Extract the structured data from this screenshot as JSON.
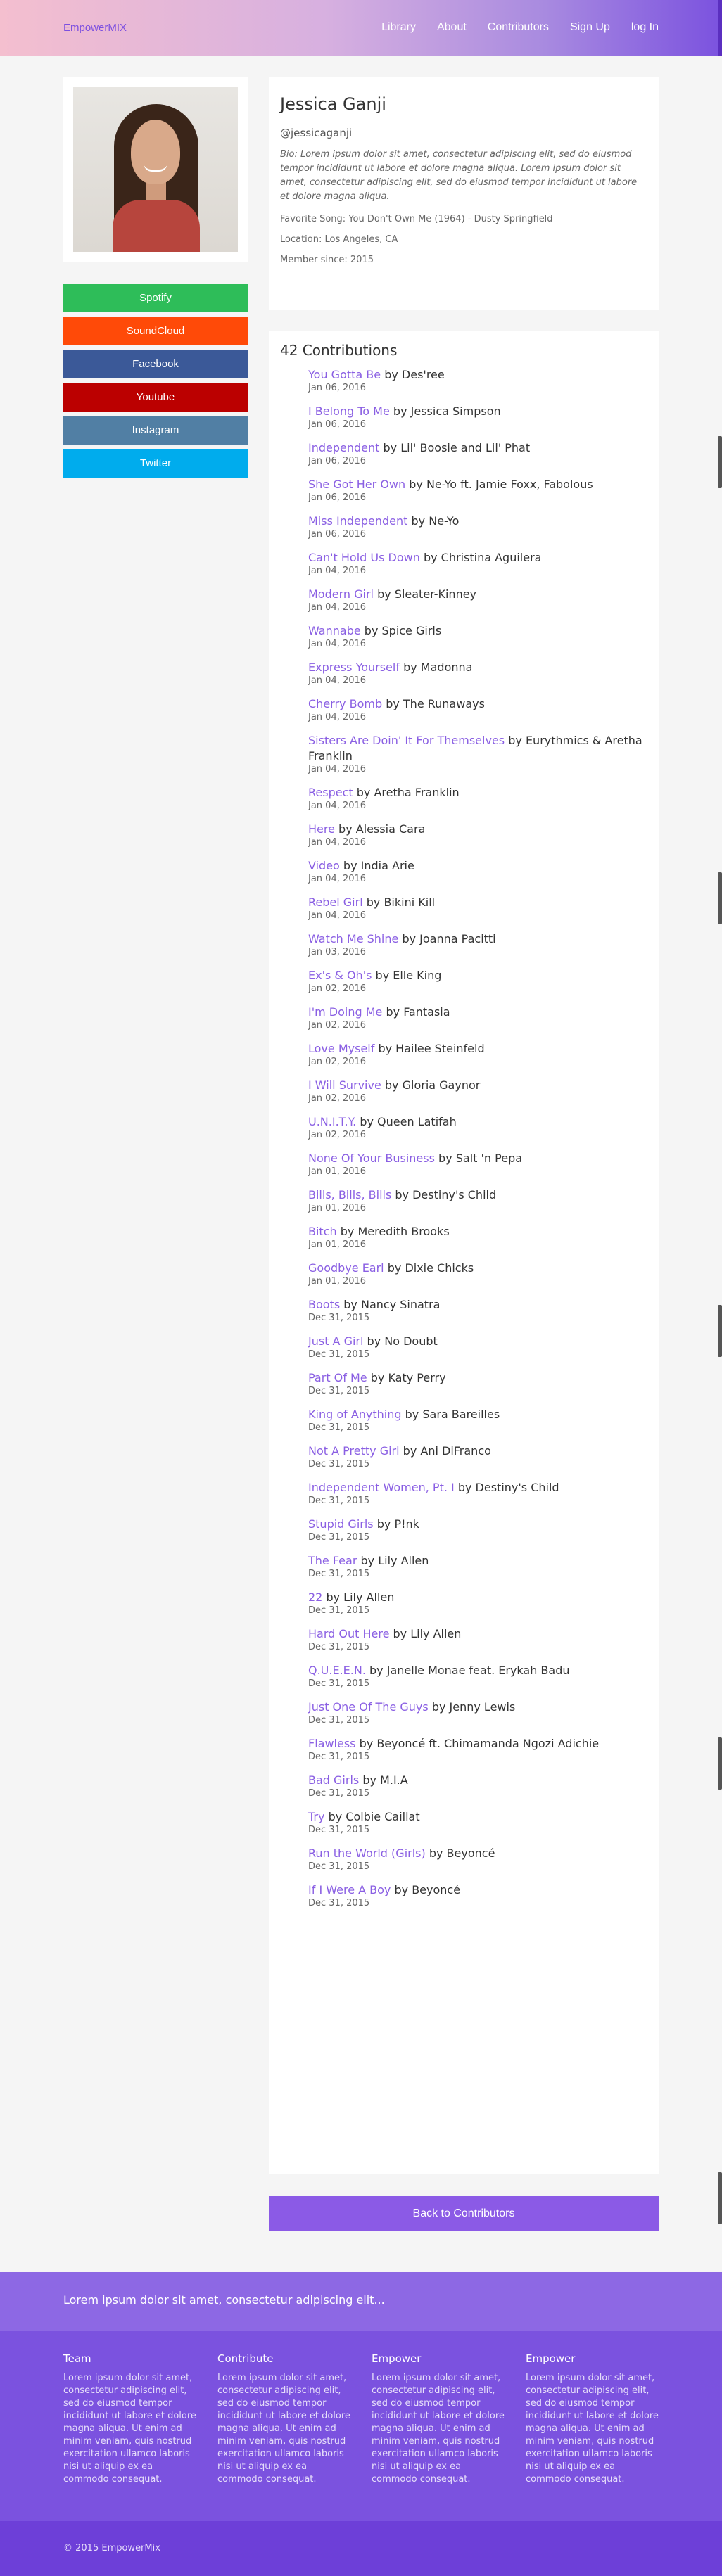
{
  "nav": {
    "brand": "EmpowerMIX",
    "links": [
      "Library",
      "About",
      "Contributors",
      "Sign Up",
      "log In"
    ]
  },
  "social": [
    {
      "label": "Spotify",
      "color": "#2ebd59"
    },
    {
      "label": "SoundCloud",
      "color": "#ff4a08"
    },
    {
      "label": "Facebook",
      "color": "#3b5998"
    },
    {
      "label": "Youtube",
      "color": "#bb0000"
    },
    {
      "label": "Instagram",
      "color": "#517fa4"
    },
    {
      "label": "Twitter",
      "color": "#00aced"
    }
  ],
  "profile": {
    "name": "Jessica Ganji",
    "handle": "@jessicaganji",
    "bio": "Bio: Lorem ipsum dolor sit amet, consectetur adipiscing elit, sed do eiusmod tempor incididunt ut labore et dolore magna aliqua. Lorem ipsum dolor sit amet, consectetur adipiscing elit, sed do eiusmod tempor incididunt ut labore et dolore magna aliqua.",
    "favorite_song": "Favorite Song: You Don't Own Me (1964) - Dusty Springfield",
    "location": "Location: Los Angeles, CA",
    "member_since": "Member since: 2015"
  },
  "contributions": {
    "title": "42 Contributions",
    "by": "by",
    "items": [
      {
        "song": "You Gotta Be",
        "artist": "Des'ree",
        "date": "Jan 06, 2016"
      },
      {
        "song": "I Belong To Me",
        "artist": "Jessica Simpson",
        "date": "Jan 06, 2016"
      },
      {
        "song": "Independent",
        "artist": "Lil' Boosie and Lil' Phat",
        "date": "Jan 06, 2016"
      },
      {
        "song": "She Got Her Own",
        "artist": "Ne-Yo ft. Jamie Foxx, Fabolous",
        "date": "Jan 06, 2016"
      },
      {
        "song": "Miss Independent",
        "artist": "Ne-Yo",
        "date": "Jan 06, 2016"
      },
      {
        "song": "Can't Hold Us Down",
        "artist": "Christina Aguilera",
        "date": "Jan 04, 2016"
      },
      {
        "song": "Modern Girl",
        "artist": "Sleater-Kinney",
        "date": "Jan 04, 2016"
      },
      {
        "song": "Wannabe",
        "artist": "Spice Girls",
        "date": "Jan 04, 2016"
      },
      {
        "song": "Express Yourself",
        "artist": "Madonna",
        "date": "Jan 04, 2016"
      },
      {
        "song": "Cherry Bomb",
        "artist": "The Runaways",
        "date": "Jan 04, 2016"
      },
      {
        "song": "Sisters Are Doin' It For Themselves",
        "artist": "Eurythmics & Aretha Franklin",
        "date": "Jan 04, 2016"
      },
      {
        "song": "Respect",
        "artist": "Aretha Franklin",
        "date": "Jan 04, 2016"
      },
      {
        "song": "Here",
        "artist": "Alessia Cara",
        "date": "Jan 04, 2016"
      },
      {
        "song": "Video",
        "artist": "India Arie",
        "date": "Jan 04, 2016"
      },
      {
        "song": "Rebel Girl",
        "artist": "Bikini Kill",
        "date": "Jan 04, 2016"
      },
      {
        "song": "Watch Me Shine",
        "artist": "Joanna Pacitti",
        "date": "Jan 03, 2016"
      },
      {
        "song": "Ex's & Oh's",
        "artist": "Elle King",
        "date": "Jan 02, 2016"
      },
      {
        "song": "I'm Doing Me",
        "artist": "Fantasia",
        "date": "Jan 02, 2016"
      },
      {
        "song": "Love Myself",
        "artist": "Hailee Steinfeld",
        "date": "Jan 02, 2016"
      },
      {
        "song": "I Will Survive",
        "artist": "Gloria Gaynor",
        "date": "Jan 02, 2016"
      },
      {
        "song": "U.N.I.T.Y.",
        "artist": "Queen Latifah",
        "date": "Jan 02, 2016"
      },
      {
        "song": "None Of Your Business",
        "artist": "Salt 'n Pepa",
        "date": "Jan 01, 2016"
      },
      {
        "song": "Bills, Bills, Bills",
        "artist": "Destiny's Child",
        "date": "Jan 01, 2016"
      },
      {
        "song": "Bitch",
        "artist": "Meredith Brooks",
        "date": "Jan 01, 2016"
      },
      {
        "song": "Goodbye Earl",
        "artist": "Dixie Chicks",
        "date": "Jan 01, 2016"
      },
      {
        "song": "Boots",
        "artist": "Nancy Sinatra",
        "date": "Dec 31, 2015"
      },
      {
        "song": "Just A Girl",
        "artist": "No Doubt",
        "date": "Dec 31, 2015"
      },
      {
        "song": "Part Of Me",
        "artist": "Katy Perry",
        "date": "Dec 31, 2015"
      },
      {
        "song": "King of Anything",
        "artist": "Sara Bareilles",
        "date": "Dec 31, 2015"
      },
      {
        "song": "Not A Pretty Girl",
        "artist": "Ani DiFranco",
        "date": "Dec 31, 2015"
      },
      {
        "song": "Independent Women, Pt. I",
        "artist": "Destiny's Child",
        "date": "Dec 31, 2015"
      },
      {
        "song": "Stupid Girls",
        "artist": "P!nk",
        "date": "Dec 31, 2015"
      },
      {
        "song": "The Fear",
        "artist": "Lily Allen",
        "date": "Dec 31, 2015"
      },
      {
        "song": "22",
        "artist": "Lily Allen",
        "date": "Dec 31, 2015"
      },
      {
        "song": "Hard Out Here",
        "artist": "Lily Allen",
        "date": "Dec 31, 2015"
      },
      {
        "song": "Q.U.E.E.N.",
        "artist": "Janelle Monae feat. Erykah Badu",
        "date": "Dec 31, 2015"
      },
      {
        "song": "Just One Of The Guys",
        "artist": "Jenny Lewis",
        "date": "Dec 31, 2015"
      },
      {
        "song": "Flawless",
        "artist": "Beyoncé ft. Chimamanda Ngozi Adichie",
        "date": "Dec 31, 2015"
      },
      {
        "song": "Bad Girls",
        "artist": "M.I.A",
        "date": "Dec 31, 2015"
      },
      {
        "song": "Try",
        "artist": "Colbie Caillat",
        "date": "Dec 31, 2015"
      },
      {
        "song": "Run the World (Girls)",
        "artist": "Beyoncé",
        "date": "Dec 31, 2015"
      },
      {
        "song": "If I Were A Boy",
        "artist": "Beyoncé",
        "date": "Dec 31, 2015"
      }
    ]
  },
  "back_button": "Back to Contributors",
  "footer": {
    "tagline": "Lorem ipsum dolor sit amet, consectetur adipiscing elit...",
    "columns": [
      {
        "heading": "Team",
        "text": "Lorem ipsum dolor sit amet, consectetur adipiscing elit, sed do eiusmod tempor incididunt ut labore et dolore magna aliqua. Ut enim ad minim veniam, quis nostrud exercitation ullamco laboris nisi ut aliquip ex ea commodo consequat."
      },
      {
        "heading": "Contribute",
        "text": "Lorem ipsum dolor sit amet, consectetur adipiscing elit, sed do eiusmod tempor incididunt ut labore et dolore magna aliqua. Ut enim ad minim veniam, quis nostrud exercitation ullamco laboris nisi ut aliquip ex ea commodo consequat."
      },
      {
        "heading": "Empower",
        "text": "Lorem ipsum dolor sit amet, consectetur adipiscing elit, sed do eiusmod tempor incididunt ut labore et dolore magna aliqua. Ut enim ad minim veniam, quis nostrud exercitation ullamco laboris nisi ut aliquip ex ea commodo consequat."
      },
      {
        "heading": "Empower",
        "text": "Lorem ipsum dolor sit amet, consectetur adipiscing elit, sed do eiusmod tempor incididunt ut labore et dolore magna aliqua. Ut enim ad minim veniam, quis nostrud exercitation ullamco laboris nisi ut aliquip ex ea commodo consequat."
      }
    ],
    "copyright": "© 2015 EmpowerMix"
  },
  "colors": {
    "accent": "#7b52df",
    "link": "#8a5fe3"
  }
}
